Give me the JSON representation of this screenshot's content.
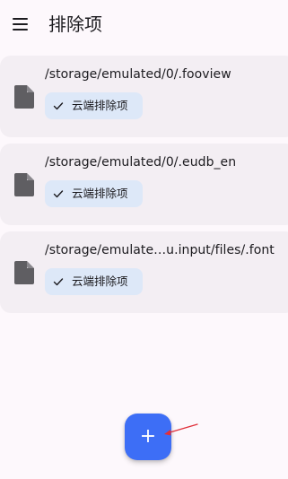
{
  "app_bar": {
    "title": "排除项",
    "menu_icon": "menu-icon"
  },
  "exclusions": [
    {
      "path": "/storage/emulated/0/.fooview",
      "chip_label": "云端排除项",
      "icon": "file-icon",
      "chip_icon": "check-icon"
    },
    {
      "path": "/storage/emulated/0/.eudb_en",
      "chip_label": "云端排除项",
      "icon": "file-icon",
      "chip_icon": "check-icon"
    },
    {
      "path": "/storage/emulate…u.input/files/.font",
      "chip_label": "云端排除项",
      "icon": "file-icon",
      "chip_icon": "check-icon"
    }
  ],
  "fab": {
    "label": "+",
    "icon": "plus-icon"
  },
  "colors": {
    "background": "#fdf8fc",
    "card": "#f3eef3",
    "chip": "#dde8f8",
    "fab": "#3d6ef6",
    "annotation": "#e0303a"
  }
}
